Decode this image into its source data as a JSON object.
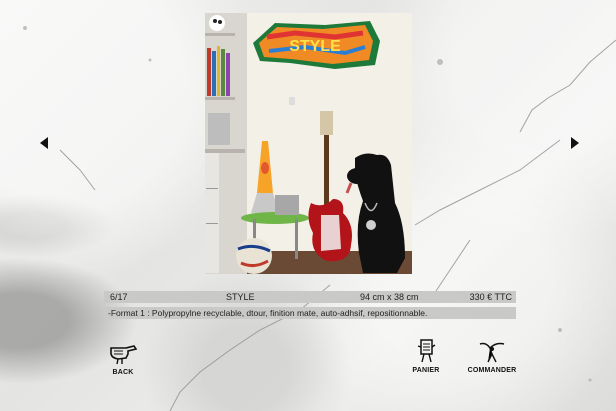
{
  "gallery": {
    "index": "6/17",
    "title": "STYLE",
    "dimensions": "94 cm x 38 cm",
    "price": "330 € TTC",
    "description": "-Format 1 : Polypropylne recyclable, dtour,  finition mate, auto-adhsif, repositionnable."
  },
  "nav": {
    "back_label": "BACK",
    "basket_label": "PANIER",
    "order_label": "COMMANDER"
  },
  "photo": {
    "graffiti_text": "STYLE"
  },
  "icons": {
    "prev": "triangle-left-icon",
    "next": "triangle-right-icon",
    "back": "pointing-hand-icon",
    "basket": "basket-figure-icon",
    "order": "bird-figure-icon"
  }
}
